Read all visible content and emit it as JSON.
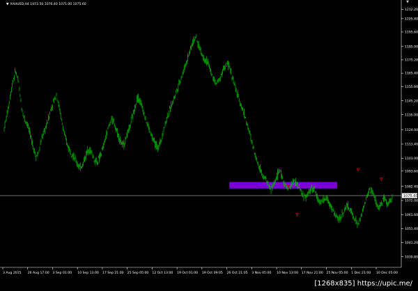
{
  "symbol_label": "XAUUSD,H4  1072.50 1076.40 1071.00 1075.60",
  "symbol_marker": "▼",
  "corner_marker": "▼",
  "current_price": "1075.60",
  "watermark": "[1268x835] https://upic.me/",
  "colors": {
    "background": "#000000",
    "candles": "#00c000",
    "zone": "#7b00d6",
    "arrows": "#d00000",
    "price_line": "#9a9a9a"
  },
  "chart_data": {
    "type": "line",
    "title": "",
    "xlabel": "",
    "ylabel": "",
    "ylim": [
      1023.0,
      1215.0
    ],
    "y_ticks": [
      "1212.20",
      "1205.40",
      "1195.60",
      "1185.00",
      "1175.20",
      "1165.40",
      "1155.60",
      "1145.20",
      "1135.00",
      "1124.00",
      "1113.40",
      "1103.00",
      "1093.60",
      "1082.40",
      "1072.00",
      "1061.60",
      "1051.40",
      "1041.20",
      "1030.80",
      "1020.40"
    ],
    "x_ticks": [
      "3 Aug 2015",
      "26 Aug 17:00",
      "3 Sep 01:00",
      "10 Sep 13:00",
      "17 Sep 21:00",
      "25 Sep 05:00",
      "12 Oct 13:00",
      "19 Oct 01:00",
      "19 Oct 09:05",
      "26 Oct 21:05",
      "3 Nov 05:00",
      "10 Nov 13:00",
      "17 Nov 21:00",
      "25 Nov 05:00",
      "1 Dec 21:00",
      "10 Dec 05:00"
    ],
    "series": [
      {
        "values": [
          1125,
          1135,
          1148,
          1160,
          1167,
          1158,
          1140,
          1132,
          1128,
          1120,
          1112,
          1104,
          1108,
          1118,
          1124,
          1130,
          1138,
          1144,
          1150,
          1140,
          1128,
          1118,
          1112,
          1108,
          1104,
          1100,
          1096,
          1098,
          1104,
          1110,
          1108,
          1102,
          1100,
          1104,
          1110,
          1118,
          1126,
          1132,
          1128,
          1122,
          1116,
          1112,
          1118,
          1124,
          1132,
          1140,
          1148,
          1144,
          1138,
          1130,
          1124,
          1118,
          1114,
          1110,
          1116,
          1124,
          1132,
          1138,
          1144,
          1150,
          1156,
          1162,
          1168,
          1175,
          1182,
          1188,
          1192,
          1186,
          1180,
          1176,
          1174,
          1168,
          1162,
          1158,
          1160,
          1166,
          1170,
          1172,
          1168,
          1160,
          1152,
          1146,
          1140,
          1134,
          1126,
          1118,
          1110,
          1102,
          1096,
          1092,
          1088,
          1084,
          1080,
          1084,
          1090,
          1094,
          1088,
          1082,
          1080,
          1084,
          1086,
          1084,
          1080,
          1076,
          1074,
          1078,
          1082,
          1080,
          1074,
          1070,
          1072,
          1074,
          1070,
          1066,
          1062,
          1058,
          1060,
          1064,
          1068,
          1066,
          1062,
          1058,
          1054,
          1060,
          1068,
          1074,
          1080,
          1078,
          1072,
          1066,
          1070,
          1074,
          1068,
          1072,
          1076
        ]
      }
    ],
    "resistance_zone": {
      "low": 1080.8,
      "high": 1085.6,
      "x_start_fraction": 0.57,
      "x_end_fraction": 0.84
    },
    "current_price": 1075.6,
    "down_arrows": [
      {
        "index": 98,
        "price": 1082.0
      },
      {
        "index": 101,
        "price": 1061.5
      },
      {
        "index": 122,
        "price": 1094.5
      },
      {
        "index": 130,
        "price": 1087.5
      }
    ]
  }
}
